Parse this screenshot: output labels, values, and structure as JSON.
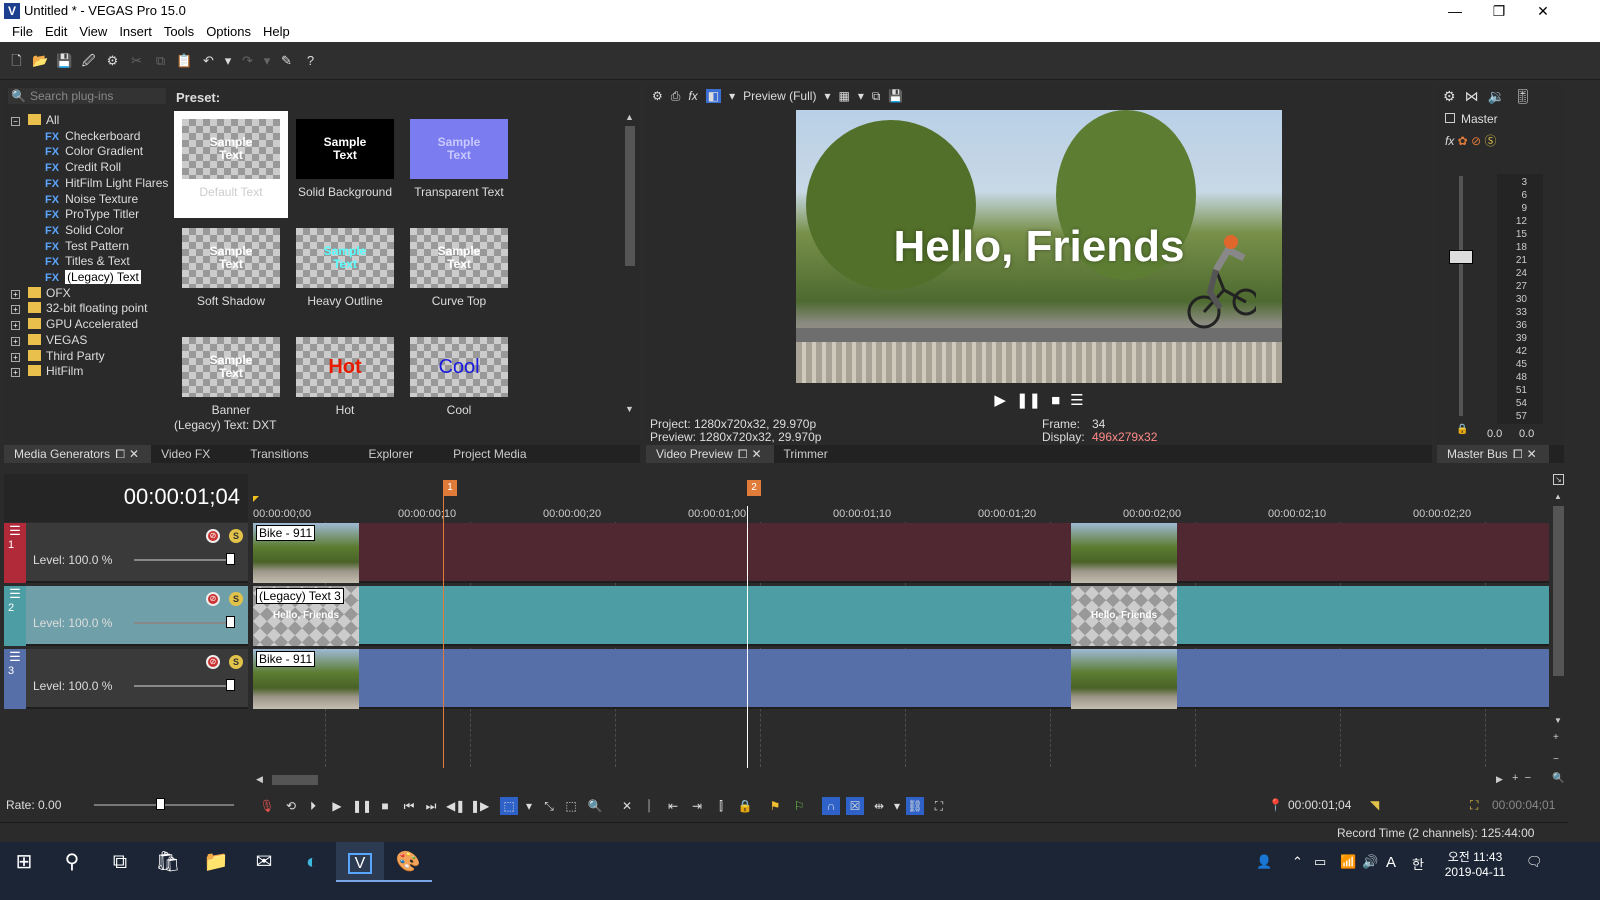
{
  "window": {
    "title": "Untitled * - VEGAS Pro 15.0",
    "minimize": "—",
    "maximize": "❐",
    "close": "✕"
  },
  "menu": [
    "File",
    "Edit",
    "View",
    "Insert",
    "Tools",
    "Options",
    "Help"
  ],
  "plugins": {
    "search_placeholder": "Search plug-ins",
    "tree": [
      {
        "type": "folder",
        "label": "All",
        "expanded": true
      },
      {
        "type": "fx",
        "label": "Checkerboard"
      },
      {
        "type": "fx",
        "label": "Color Gradient"
      },
      {
        "type": "fx",
        "label": "Credit Roll"
      },
      {
        "type": "fx",
        "label": "HitFilm Light Flares"
      },
      {
        "type": "fx",
        "label": "Noise Texture"
      },
      {
        "type": "fx",
        "label": "ProType Titler"
      },
      {
        "type": "fx",
        "label": "Solid Color"
      },
      {
        "type": "fx",
        "label": "Test Pattern"
      },
      {
        "type": "fx",
        "label": "Titles & Text"
      },
      {
        "type": "fx",
        "label": "(Legacy) Text",
        "selected": true
      },
      {
        "type": "folder",
        "label": "OFX"
      },
      {
        "type": "folder",
        "label": "32-bit floating point"
      },
      {
        "type": "folder",
        "label": "GPU Accelerated"
      },
      {
        "type": "folder",
        "label": "VEGAS"
      },
      {
        "type": "folder",
        "label": "Third Party"
      },
      {
        "type": "folder",
        "label": "HitFilm"
      }
    ]
  },
  "presets": {
    "label": "Preset:",
    "items": [
      {
        "thumb": "Sample Text",
        "caption": "Default Text"
      },
      {
        "thumb": "Sample Text",
        "caption": "Solid Background"
      },
      {
        "thumb": "Sample Text",
        "caption": "Transparent Text"
      },
      {
        "thumb": "Sample Text",
        "caption": "Soft Shadow"
      },
      {
        "thumb": "Sample Text",
        "caption": "Heavy Outline"
      },
      {
        "thumb": "Sample Text",
        "caption": "Curve Top"
      },
      {
        "thumb": "Sample Text",
        "caption": "Banner"
      },
      {
        "thumb": "Hot",
        "caption": "Hot"
      },
      {
        "thumb": "Cool",
        "caption": "Cool"
      }
    ],
    "status": "(Legacy) Text: DXT"
  },
  "left_tabs": [
    "Media Generators",
    "Video FX",
    "Transitions",
    "Explorer",
    "Project Media"
  ],
  "preview": {
    "quality": "Preview (Full)",
    "overlay_text": "Hello, Friends",
    "project": "Project:  1280x720x32, 29.970p",
    "preview": "Preview: 1280x720x32, 29.970p",
    "frame_label": "Frame:",
    "frame_value": "34",
    "display_label": "Display:",
    "display_value": "496x279x32",
    "tabs": [
      "Video Preview",
      "Trimmer"
    ]
  },
  "master": {
    "label": "Master",
    "scale": [
      "3",
      "6",
      "9",
      "12",
      "15",
      "18",
      "21",
      "24",
      "27",
      "30",
      "33",
      "36",
      "39",
      "42",
      "45",
      "48",
      "51",
      "54",
      "57"
    ],
    "left_value": "0.0",
    "right_value": "0.0",
    "tab": "Master Bus"
  },
  "timeline": {
    "timecode": "00:00:01;04",
    "ruler": [
      "00:00:00;00",
      "00:00:00;10",
      "00:00:00;20",
      "00:00:01;00",
      "00:00:01;10",
      "00:00:01;20",
      "00:00:02;00",
      "00:00:02;10",
      "00:00:02;20"
    ],
    "markers": [
      "1",
      "2"
    ],
    "tracks": [
      {
        "num": "1",
        "level": "Level: 100.0 %",
        "clip": "Bike - 911",
        "color": "#4f2832"
      },
      {
        "num": "2",
        "level": "Level: 100.0 %",
        "clip": "(Legacy) Text 3",
        "color": "#4c9ea4",
        "thumb_text": "Hello, Friends"
      },
      {
        "num": "3",
        "level": "Level: 100.0 %",
        "clip": "Bike - 911",
        "color": "#566fa8"
      }
    ],
    "rate": "Rate: 0.00",
    "cursor_time": "00:00:01;04",
    "end_time": "00:00:04;01",
    "record_time": "Record Time (2 channels): 125:44:00"
  },
  "taskbar": {
    "time": "오전 11:43",
    "date": "2019-04-11",
    "ime": "A",
    "lang": "한"
  }
}
